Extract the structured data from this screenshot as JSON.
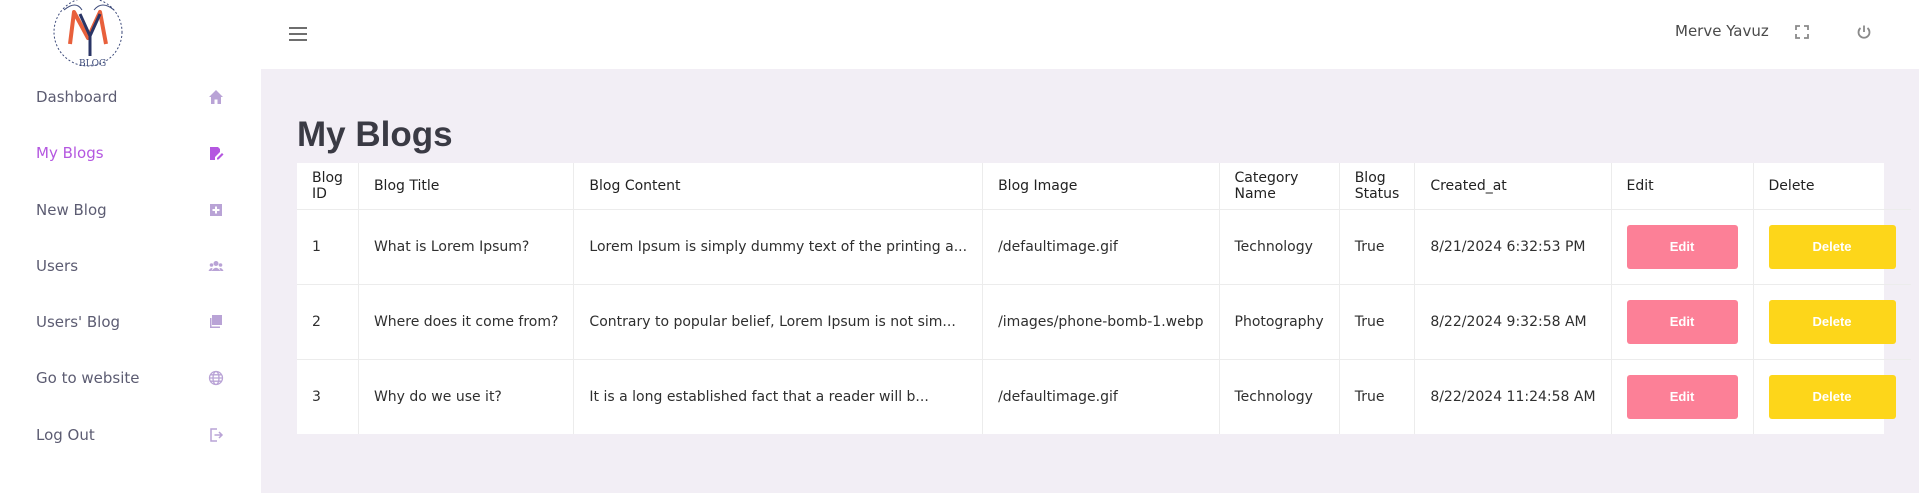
{
  "logo": {
    "brand_text": "BLOG",
    "monogram": "MY"
  },
  "sidebar": {
    "items": [
      {
        "label": "Dashboard",
        "icon": "home-icon",
        "active": false
      },
      {
        "label": "My Blogs",
        "icon": "edit-note-icon",
        "active": true
      },
      {
        "label": "New Blog",
        "icon": "plus-box-icon",
        "active": false
      },
      {
        "label": "Users",
        "icon": "users-icon",
        "active": false
      },
      {
        "label": "Users' Blog",
        "icon": "library-icon",
        "active": false
      },
      {
        "label": "Go to website",
        "icon": "globe-icon",
        "active": false
      },
      {
        "label": "Log Out",
        "icon": "logout-icon",
        "active": false
      }
    ]
  },
  "header": {
    "menu_icon": "hamburger-icon",
    "user_name": "Merve Yavuz",
    "fullscreen_icon": "fullscreen-icon",
    "power_icon": "power-icon"
  },
  "main": {
    "title": "My Blogs",
    "table": {
      "columns": [
        "Blog ID",
        "Blog Title",
        "Blog Content",
        "Blog Image",
        "Category Name",
        "Blog Status",
        "Created_at",
        "Edit",
        "Delete"
      ],
      "rows": [
        {
          "id": "1",
          "title": "What is Lorem Ipsum?",
          "content": "Lorem Ipsum is simply dummy text of the printing a...",
          "image": "/defaultimage.gif",
          "category": "Technology",
          "status": "True",
          "created_at": "8/21/2024 6:32:53 PM",
          "edit": "Edit",
          "delete": "Delete"
        },
        {
          "id": "2",
          "title": "Where does it come from?",
          "content": "Contrary to popular belief, Lorem Ipsum is not sim...",
          "image": "/images/phone-bomb-1.webp",
          "category": "Photography",
          "status": "True",
          "created_at": "8/22/2024 9:32:58 AM",
          "edit": "Edit",
          "delete": "Delete"
        },
        {
          "id": "3",
          "title": "Why do we use it?",
          "content": "It is a long established fact that a reader will b...",
          "image": "/defaultimage.gif",
          "category": "Technology",
          "status": "True",
          "created_at": "8/22/2024 11:24:58 AM",
          "edit": "Edit",
          "delete": "Delete"
        }
      ]
    }
  },
  "colors": {
    "accent": "#b457e0",
    "background": "#f2eef5",
    "edit_button": "#fc8097",
    "delete_button": "#fdd61a"
  }
}
